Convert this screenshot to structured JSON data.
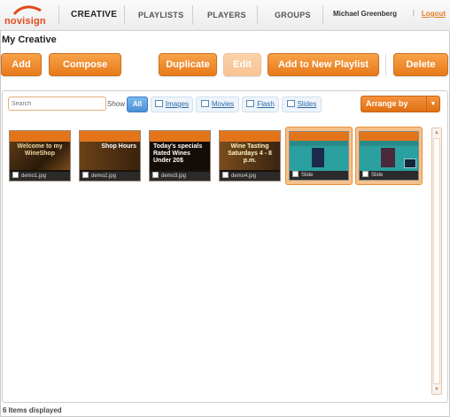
{
  "header": {
    "logo_text_left": "novi",
    "logo_text_right": "sign",
    "nav": [
      "CREATIVE",
      "PLAYLISTS",
      "PLAYERS",
      "GROUPS"
    ],
    "user_name": "Michael Greenberg",
    "separator": "|",
    "logout_label": "Logout"
  },
  "page": {
    "title": "My Creative"
  },
  "toolbar": {
    "add": "Add",
    "compose": "Compose",
    "duplicate": "Duplicate",
    "edit": "Edit",
    "add_to_playlist": "Add to New Playlist",
    "delete": "Delete"
  },
  "filters": {
    "search_placeholder": "Search",
    "show_label": "Show",
    "all": "All",
    "images": "Images",
    "movies": "Movies",
    "flash": "Flash",
    "slides": "Slides",
    "arrange_by": "Arrange by"
  },
  "items": [
    {
      "caption": "demo1.jpg",
      "overlay": "Welcome to my WineShop"
    },
    {
      "caption": "demo2.jpg",
      "overlay": "Shop Hours"
    },
    {
      "caption": "demo3.jpg",
      "overlay": "Today's specials Rated Wines Under 20$"
    },
    {
      "caption": "demo4.jpg",
      "overlay": "Wine Tasting Saturdays 4 - 8 p.m."
    },
    {
      "caption": "Slide",
      "overlay": ""
    },
    {
      "caption": "Slide",
      "overlay": ""
    }
  ],
  "status": {
    "items_displayed": "6 Items displayed"
  },
  "colors": {
    "accent": "#e77a1a",
    "link": "#2a6aa6",
    "teal": "#2aa0a0"
  }
}
